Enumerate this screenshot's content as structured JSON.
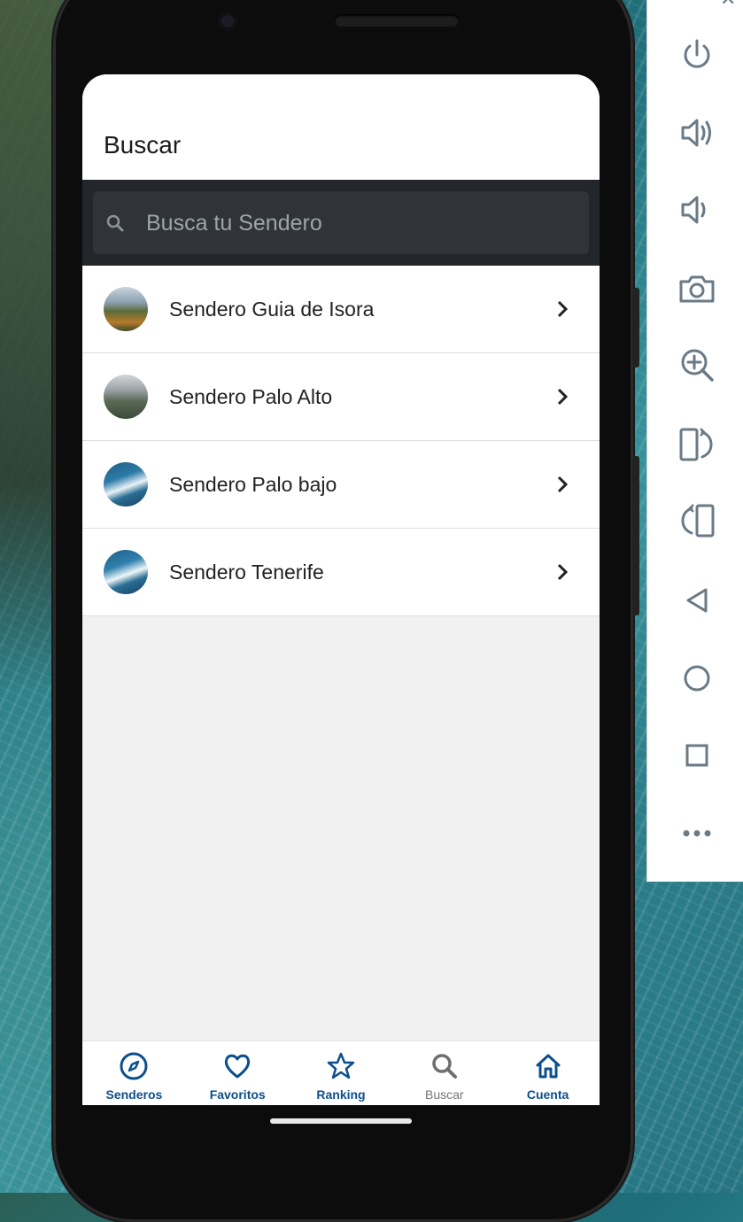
{
  "screen": {
    "title": "Buscar",
    "search": {
      "placeholder": "Busca tu Sendero"
    },
    "trails": [
      {
        "name": "Sendero Guia de Isora",
        "thumbnail": "mountain-valley-photo"
      },
      {
        "name": "Sendero Palo Alto",
        "thumbnail": "misty-mountain-photo"
      },
      {
        "name": "Sendero Palo bajo",
        "thumbnail": "ocean-waves-photo"
      },
      {
        "name": "Sendero Tenerife",
        "thumbnail": "ocean-waves-photo"
      }
    ]
  },
  "bottom_nav": {
    "items": [
      {
        "label": "Senderos",
        "icon": "compass-icon",
        "active": true
      },
      {
        "label": "Favoritos",
        "icon": "heart-icon",
        "active": true
      },
      {
        "label": "Ranking",
        "icon": "star-icon",
        "active": true
      },
      {
        "label": "Buscar",
        "icon": "search-icon",
        "active": false
      },
      {
        "label": "Cuenta",
        "icon": "home-icon",
        "active": true
      }
    ]
  },
  "emulator_toolbar": {
    "buttons": [
      "power-icon",
      "volume-up-icon",
      "volume-down-icon",
      "camera-icon",
      "zoom-in-icon",
      "rotate-right-icon",
      "rotate-left-icon",
      "back-icon",
      "home-icon",
      "overview-icon",
      "more-icon"
    ]
  },
  "colors": {
    "accent": "#0d4f8c",
    "inactive": "#727578",
    "search_bar_bg": "#23262b",
    "search_field_bg": "#303339",
    "toolbar_icon": "#6a7a86"
  }
}
